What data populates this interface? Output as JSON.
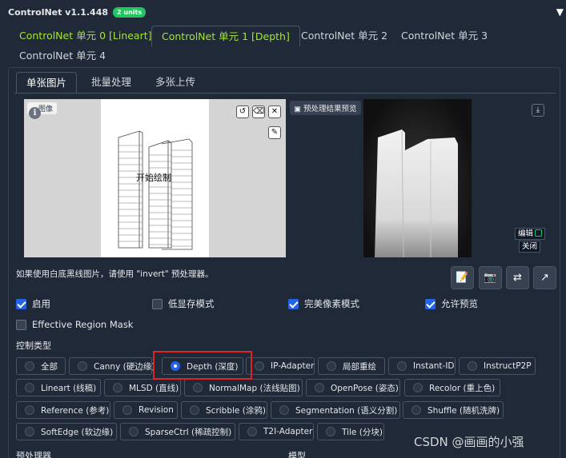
{
  "header": {
    "title": "ControlNet v1.1.448",
    "units_badge": "2 units"
  },
  "unit_tabs": [
    {
      "label": "ControlNet 单元 0 [Lineart]"
    },
    {
      "label": "ControlNet 单元 1 [Depth]"
    },
    {
      "label": "ControlNet 单元 2"
    },
    {
      "label": "ControlNet 单元 3"
    },
    {
      "label": "ControlNet 单元 4"
    }
  ],
  "image_tabs": [
    {
      "label": "单张图片"
    },
    {
      "label": "批量处理"
    },
    {
      "label": "多张上传"
    }
  ],
  "canvas": {
    "label": "图像",
    "draw_hint": "开始绘制"
  },
  "preview": {
    "label": "预处理结果预览",
    "edit_label": "编辑",
    "close_label": "关闭"
  },
  "invert_hint": "如果使用白底黑线图片，请使用 \"invert\" 预处理器。",
  "checkboxes": [
    {
      "label": "启用",
      "checked": true
    },
    {
      "label": "低显存模式",
      "checked": false
    },
    {
      "label": "完美像素模式",
      "checked": true
    },
    {
      "label": "允许预览",
      "checked": true
    },
    {
      "label": "Effective Region Mask",
      "checked": false
    }
  ],
  "control_type_label": "控制类型",
  "control_types": [
    {
      "label": "全部",
      "selected": false
    },
    {
      "label": "Canny (硬边缘)",
      "selected": false
    },
    {
      "label": "Depth (深度)",
      "selected": true
    },
    {
      "label": "IP-Adapter",
      "selected": false
    },
    {
      "label": "局部重绘",
      "selected": false
    },
    {
      "label": "Instant-ID",
      "selected": false
    },
    {
      "label": "InstructP2P",
      "selected": false
    },
    {
      "label": "Lineart (线稿)",
      "selected": false
    },
    {
      "label": "MLSD (直线)",
      "selected": false
    },
    {
      "label": "NormalMap (法线贴图)",
      "selected": false
    },
    {
      "label": "OpenPose (姿态)",
      "selected": false
    },
    {
      "label": "Recolor (重上色)",
      "selected": false
    },
    {
      "label": "Reference (参考)",
      "selected": false
    },
    {
      "label": "Revision",
      "selected": false
    },
    {
      "label": "Scribble (涂鸦)",
      "selected": false
    },
    {
      "label": "Segmentation (语义分割)",
      "selected": false
    },
    {
      "label": "Shuffle (随机洗牌)",
      "selected": false
    },
    {
      "label": "SoftEdge (软边缘)",
      "selected": false
    },
    {
      "label": "SparseCtrl (稀疏控制)",
      "selected": false
    },
    {
      "label": "T2I-Adapter",
      "selected": false
    },
    {
      "label": "Tile (分块)",
      "selected": false
    }
  ],
  "bottom_labels": {
    "preprocessor": "预处理器",
    "model": "模型"
  },
  "watermark": "CSDN @画画的小强",
  "icons": {
    "collapse": "triangle-down-icon",
    "info": "info-icon",
    "undo": "undo-icon",
    "erase": "eraser-icon",
    "close": "close-icon",
    "brush": "brush-icon",
    "image": "image-icon",
    "download": "download-icon",
    "note": "note-icon",
    "camera": "camera-icon",
    "swap": "swap-icon",
    "send": "send-icon"
  }
}
